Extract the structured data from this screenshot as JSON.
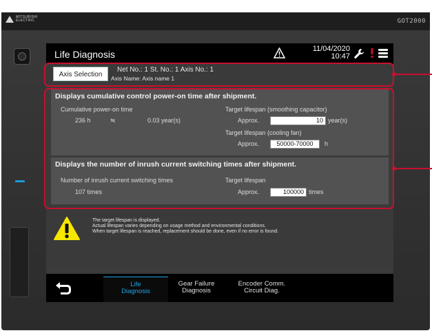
{
  "device": {
    "brand_line1": "MITSUBISHI",
    "brand_line2": "ELECTRIC",
    "model": "GOT2000"
  },
  "titlebar": {
    "title": "Life Diagnosis",
    "date": "11/04/2020",
    "time": "10:47"
  },
  "axis": {
    "button_label": "Axis Selection",
    "line1": "Net No.:  1   St. No.:  1   Axis No.:  1",
    "line2": "Axis Name: Axis name 1"
  },
  "power_on": {
    "heading": "Displays cumulative control power-on time after shipment.",
    "cumulative_label": "Cumulative power-on time",
    "hours": "236 h",
    "approx_sign": "≒",
    "years": "0.03 year(s)",
    "capacitor_label": "Target lifespan (smoothing capacitor)",
    "approx": "Approx.",
    "capacitor_value": "10",
    "capacitor_unit": "year(s)",
    "fan_label": "Target lifespan (cooling fan)",
    "fan_value": "50000-70000",
    "fan_unit": "h"
  },
  "inrush": {
    "heading": "Displays the number of inrush current switching times after shipment.",
    "count_label": "Number of inrush current switching times",
    "count": "107 times",
    "target_label": "Target lifespan",
    "approx": "Approx.",
    "target_value": "100000",
    "target_unit": "times"
  },
  "notice": {
    "icon": "warning-triangle-icon",
    "line1": "The target lifespan is displayed.",
    "line2": "Actual lifespan varies depending on usage method and environmental conditions.",
    "line3": "When target lifespan is reached, replacement should be done, even if no error is found."
  },
  "tabs": [
    {
      "line1": "Life",
      "line2": "Diagnosis",
      "active": true
    },
    {
      "line1": "Gear Failure",
      "line2": "Diagnosis",
      "active": false
    },
    {
      "line1": "Encoder Comm.",
      "line2": "Circuit Diag.",
      "active": false
    }
  ],
  "colors": {
    "accent": "#1ea6e6",
    "callout": "#c8102e",
    "warning_yellow": "#f7e600"
  }
}
